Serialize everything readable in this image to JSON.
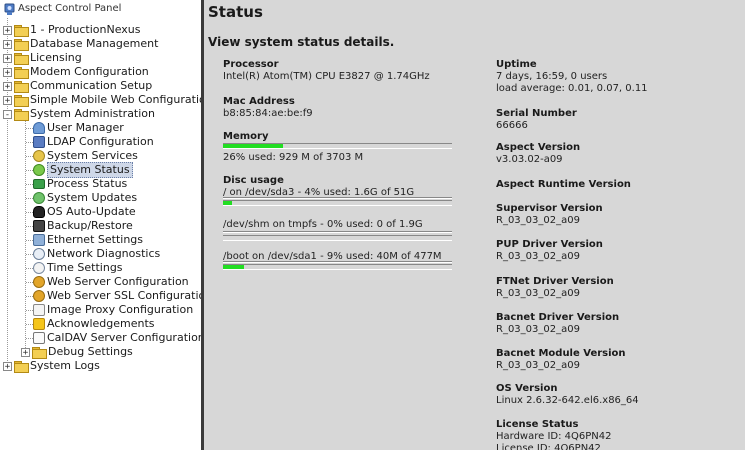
{
  "sidebar": {
    "root_label": "Aspect Control Panel",
    "items": [
      {
        "label": "1 - ProductionNexus",
        "expander": "+"
      },
      {
        "label": "Database Management",
        "expander": "+"
      },
      {
        "label": "Licensing",
        "expander": "+"
      },
      {
        "label": "Modem Configuration",
        "expander": "+"
      },
      {
        "label": "Communication Setup",
        "expander": "+"
      },
      {
        "label": "Simple Mobile Web Configuration",
        "expander": "+"
      },
      {
        "label": "System Administration",
        "expander": "-"
      }
    ],
    "admin_children": [
      {
        "label": "User Manager",
        "icon": "user-icon"
      },
      {
        "label": "LDAP Configuration",
        "icon": "ldap-users-icon"
      },
      {
        "label": "System Services",
        "icon": "services-icon"
      },
      {
        "label": "System Status",
        "icon": "status-icon"
      },
      {
        "label": "Process Status",
        "icon": "process-icon"
      },
      {
        "label": "System Updates",
        "icon": "updates-icon"
      },
      {
        "label": "OS Auto-Update",
        "icon": "linux-penguin-icon"
      },
      {
        "label": "Backup/Restore",
        "icon": "backup-icon"
      },
      {
        "label": "Ethernet Settings",
        "icon": "network-icon"
      },
      {
        "label": "Network Diagnostics",
        "icon": "magnifier-icon"
      },
      {
        "label": "Time Settings",
        "icon": "clock-icon"
      },
      {
        "label": "Web Server Configuration",
        "icon": "web-server-icon"
      },
      {
        "label": "Web Server SSL Configuration",
        "icon": "ssl-icon"
      },
      {
        "label": "Image Proxy Configuration",
        "icon": "image-icon"
      },
      {
        "label": "Acknowledgements",
        "icon": "star-icon"
      },
      {
        "label": "CalDAV Server Configuration",
        "icon": "calendar-icon"
      },
      {
        "label": "Debug Settings",
        "icon": "folder-icon"
      }
    ],
    "last_item": {
      "label": "System Logs",
      "expander": "+"
    },
    "selected": "System Status"
  },
  "main": {
    "title": "Status",
    "subtitle": "View system status details.",
    "processor": {
      "label": "Processor",
      "value": "Intel(R) Atom(TM) CPU E3827 @ 1.74GHz"
    },
    "mac": {
      "label": "Mac Address",
      "value": "b8:85:84:ae:be:f9"
    },
    "memory": {
      "label": "Memory",
      "value": "26% used: 929 M of 3703 M",
      "percent": 26
    },
    "disc": {
      "label": "Disc usage",
      "entries": [
        {
          "text": "/ on /dev/sda3 - 4% used: 1.6G of 51G",
          "percent": 4
        },
        {
          "text": "/dev/shm on tmpfs - 0% used: 0 of 1.9G",
          "percent": 0
        },
        {
          "text": "/boot on /dev/sda1 - 9% used: 40M of 477M",
          "percent": 9
        }
      ]
    },
    "uptime": {
      "label": "Uptime",
      "line1": "7 days, 16:59, 0 users",
      "line2": "load average: 0.01, 0.07, 0.11"
    },
    "serial": {
      "label": "Serial Number",
      "value": "66666"
    },
    "aspect_version": {
      "label": "Aspect Version",
      "value": "v3.03.02-a09"
    },
    "runtime_version": {
      "label": "Aspect Runtime Version"
    },
    "supervisor_version": {
      "label": "Supervisor Version",
      "value": "R_03_03_02_a09"
    },
    "pup_version": {
      "label": "PUP Driver Version",
      "value": "R_03_03_02_a09"
    },
    "ftnet_version": {
      "label": "FTNet Driver Version",
      "value": "R_03_03_02_a09"
    },
    "bacnet_driver_version": {
      "label": "Bacnet Driver Version",
      "value": "R_03_03_02_a09"
    },
    "bacnet_module_version": {
      "label": "Bacnet Module Version",
      "value": "R_03_03_02_a09"
    },
    "os_version": {
      "label": "OS Version",
      "value": "Linux 2.6.32-642.el6.x86_64"
    },
    "license": {
      "label": "License Status",
      "hardware": "Hardware ID: 4Q6PN42",
      "license_id": "License ID: 4Q6PN42"
    }
  },
  "colors": {
    "usage_bar": "#22dd22",
    "main_bg": "#d7d7d7",
    "selection": "#cfd8e8"
  }
}
